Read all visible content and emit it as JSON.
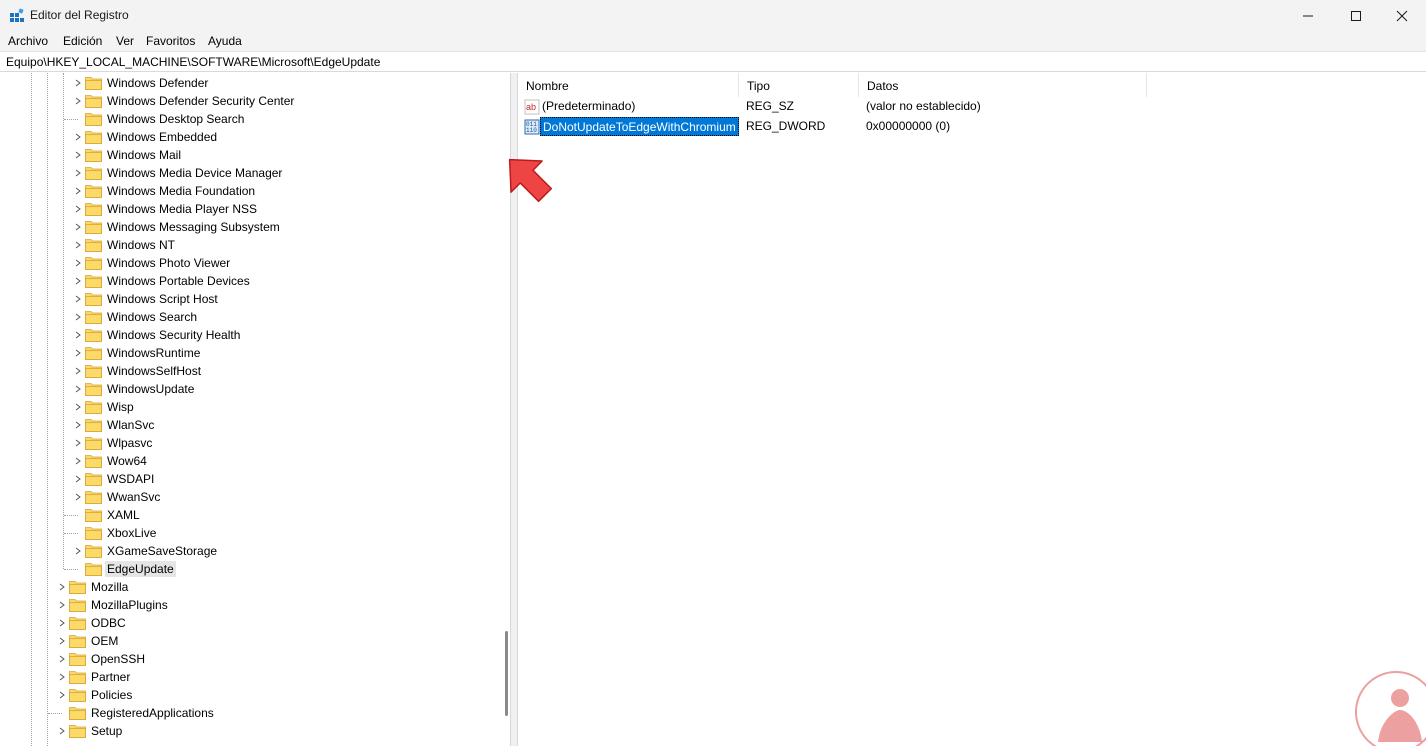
{
  "window": {
    "title": "Editor del Registro",
    "minimize_icon": "minimize-icon",
    "maximize_icon": "maximize-icon",
    "close_icon": "close-icon"
  },
  "menu": [
    "Archivo",
    "Edición",
    "Ver",
    "Favoritos",
    "Ayuda"
  ],
  "address": "Equipo\\HKEY_LOCAL_MACHINE\\SOFTWARE\\Microsoft\\EdgeUpdate",
  "tree": [
    {
      "label": "Windows Defender",
      "expandable": true,
      "level": 2
    },
    {
      "label": "Windows Defender Security Center",
      "expandable": true,
      "level": 2
    },
    {
      "label": "Windows Desktop Search",
      "expandable": false,
      "level": 2
    },
    {
      "label": "Windows Embedded",
      "expandable": true,
      "level": 2
    },
    {
      "label": "Windows Mail",
      "expandable": true,
      "level": 2
    },
    {
      "label": "Windows Media Device Manager",
      "expandable": true,
      "level": 2
    },
    {
      "label": "Windows Media Foundation",
      "expandable": true,
      "level": 2
    },
    {
      "label": "Windows Media Player NSS",
      "expandable": true,
      "level": 2
    },
    {
      "label": "Windows Messaging Subsystem",
      "expandable": true,
      "level": 2
    },
    {
      "label": "Windows NT",
      "expandable": true,
      "level": 2
    },
    {
      "label": "Windows Photo Viewer",
      "expandable": true,
      "level": 2
    },
    {
      "label": "Windows Portable Devices",
      "expandable": true,
      "level": 2
    },
    {
      "label": "Windows Script Host",
      "expandable": true,
      "level": 2
    },
    {
      "label": "Windows Search",
      "expandable": true,
      "level": 2
    },
    {
      "label": "Windows Security Health",
      "expandable": true,
      "level": 2
    },
    {
      "label": "WindowsRuntime",
      "expandable": true,
      "level": 2
    },
    {
      "label": "WindowsSelfHost",
      "expandable": true,
      "level": 2
    },
    {
      "label": "WindowsUpdate",
      "expandable": true,
      "level": 2
    },
    {
      "label": "Wisp",
      "expandable": true,
      "level": 2
    },
    {
      "label": "WlanSvc",
      "expandable": true,
      "level": 2
    },
    {
      "label": "Wlpasvc",
      "expandable": true,
      "level": 2
    },
    {
      "label": "Wow64",
      "expandable": true,
      "level": 2
    },
    {
      "label": "WSDAPI",
      "expandable": true,
      "level": 2
    },
    {
      "label": "WwanSvc",
      "expandable": true,
      "level": 2
    },
    {
      "label": "XAML",
      "expandable": false,
      "level": 2
    },
    {
      "label": "XboxLive",
      "expandable": false,
      "level": 2
    },
    {
      "label": "XGameSaveStorage",
      "expandable": true,
      "level": 2
    },
    {
      "label": "EdgeUpdate",
      "expandable": false,
      "level": 2,
      "selected": true
    },
    {
      "label": "Mozilla",
      "expandable": true,
      "level": 1
    },
    {
      "label": "MozillaPlugins",
      "expandable": true,
      "level": 1
    },
    {
      "label": "ODBC",
      "expandable": true,
      "level": 1
    },
    {
      "label": "OEM",
      "expandable": true,
      "level": 1
    },
    {
      "label": "OpenSSH",
      "expandable": true,
      "level": 1
    },
    {
      "label": "Partner",
      "expandable": true,
      "level": 1
    },
    {
      "label": "Policies",
      "expandable": true,
      "level": 1
    },
    {
      "label": "RegisteredApplications",
      "expandable": false,
      "level": 1
    },
    {
      "label": "Setup",
      "expandable": true,
      "level": 1
    }
  ],
  "columns": {
    "name": "Nombre",
    "type": "Tipo",
    "data": "Datos"
  },
  "values": [
    {
      "icon": "string-value-icon",
      "name": "(Predeterminado)",
      "type": "REG_SZ",
      "data": "(valor no establecido)",
      "selected": false
    },
    {
      "icon": "binary-value-icon",
      "name": "DoNotUpdateToEdgeWithChromium",
      "type": "REG_DWORD",
      "data": "0x00000000 (0)",
      "selected": true
    }
  ],
  "colors": {
    "selection": "#0078d7",
    "folder": "#f8d775",
    "arrow": "#ef4444",
    "watermark": "#d63636"
  }
}
